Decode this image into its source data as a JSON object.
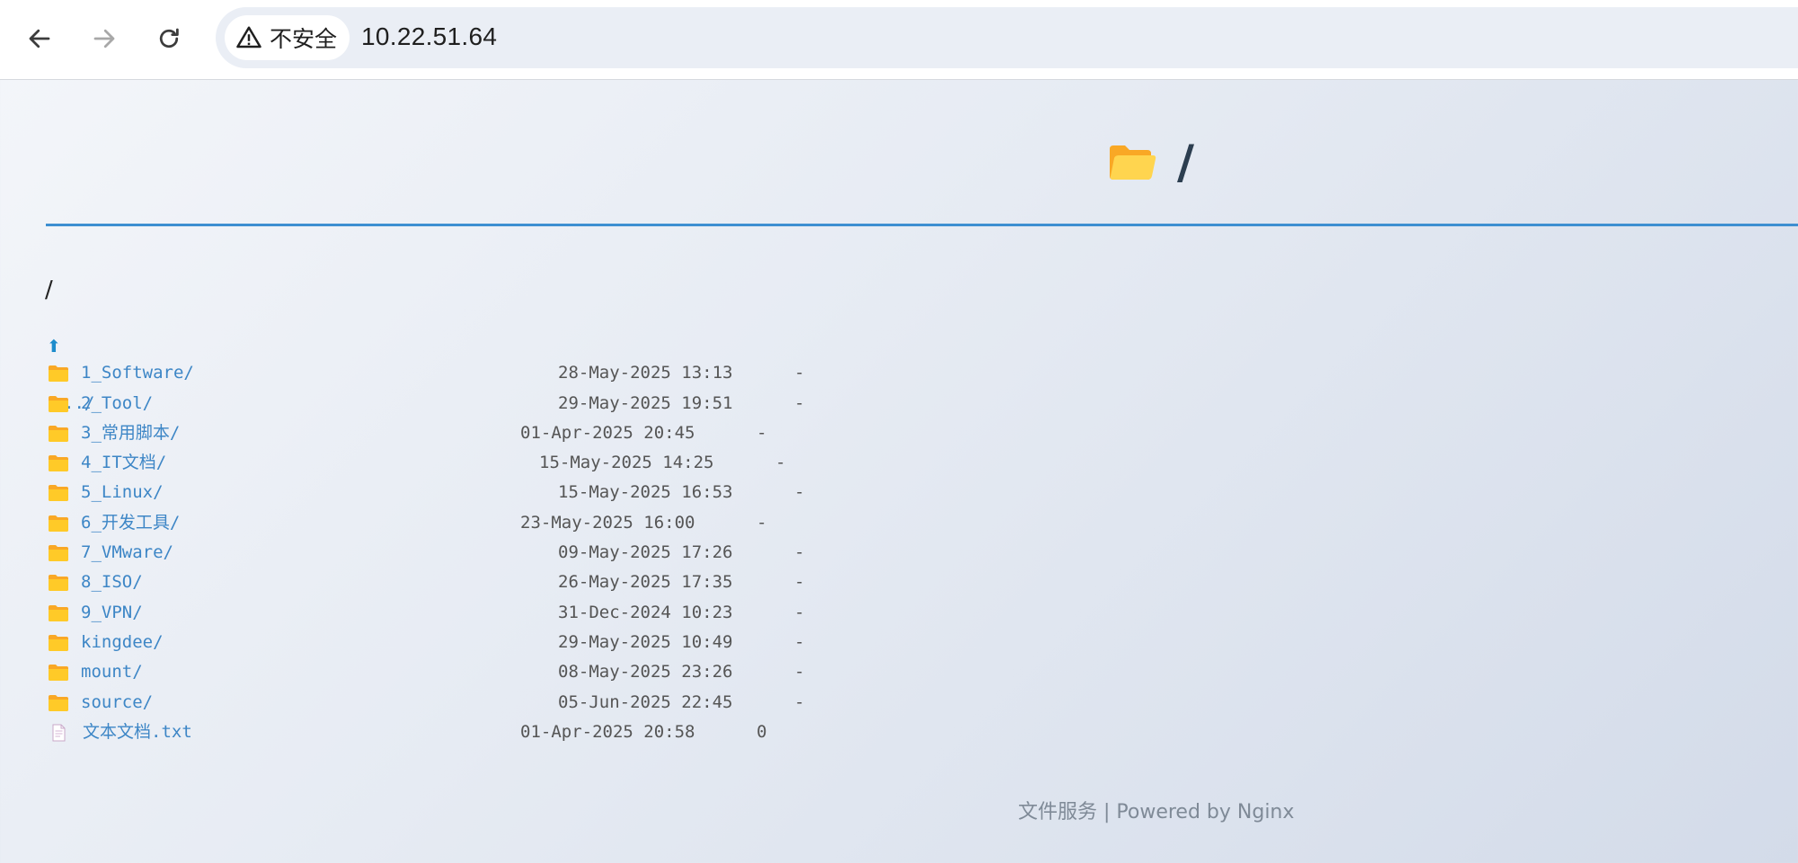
{
  "browser": {
    "security_label": "不安全",
    "url": "10.22.51.64",
    "icons": {
      "back": "arrow-left-icon",
      "forward": "arrow-right-icon",
      "reload": "reload-icon",
      "security": "warning-triangle-icon"
    }
  },
  "page": {
    "header_slash": "/",
    "path_heading": "/",
    "parent_link": "../",
    "footer": "文件服务 | Powered by Nginx",
    "colors": {
      "accent_line": "#3d8fd1",
      "link": "#3d86c6",
      "folder": "#fbc02d"
    }
  },
  "entries": [
    {
      "name": "1_Software/",
      "type": "folder",
      "date": "28-May-2025 13:13",
      "size": "-"
    },
    {
      "name": "2_Tool/",
      "type": "folder",
      "date": "29-May-2025 19:51",
      "size": "-"
    },
    {
      "name": "3_常用脚本/",
      "type": "folder",
      "date": "01-Apr-2025 20:45",
      "size": "-"
    },
    {
      "name": "4_IT文档/",
      "type": "folder",
      "date": "15-May-2025 14:25",
      "size": "-"
    },
    {
      "name": "5_Linux/",
      "type": "folder",
      "date": "15-May-2025 16:53",
      "size": "-"
    },
    {
      "name": "6_开发工具/",
      "type": "folder",
      "date": "23-May-2025 16:00",
      "size": "-"
    },
    {
      "name": "7_VMware/",
      "type": "folder",
      "date": "09-May-2025 17:26",
      "size": "-"
    },
    {
      "name": "8_ISO/",
      "type": "folder",
      "date": "26-May-2025 17:35",
      "size": "-"
    },
    {
      "name": "9_VPN/",
      "type": "folder",
      "date": "31-Dec-2024 10:23",
      "size": "-"
    },
    {
      "name": "kingdee/",
      "type": "folder",
      "date": "29-May-2025 10:49",
      "size": "-"
    },
    {
      "name": "mount/",
      "type": "folder",
      "date": "08-May-2025 23:26",
      "size": "-"
    },
    {
      "name": "source/",
      "type": "folder",
      "date": "05-Jun-2025 22:45",
      "size": "-"
    },
    {
      "name": "文本文档.txt",
      "type": "file",
      "date": "01-Apr-2025 20:58",
      "size": "0"
    }
  ]
}
